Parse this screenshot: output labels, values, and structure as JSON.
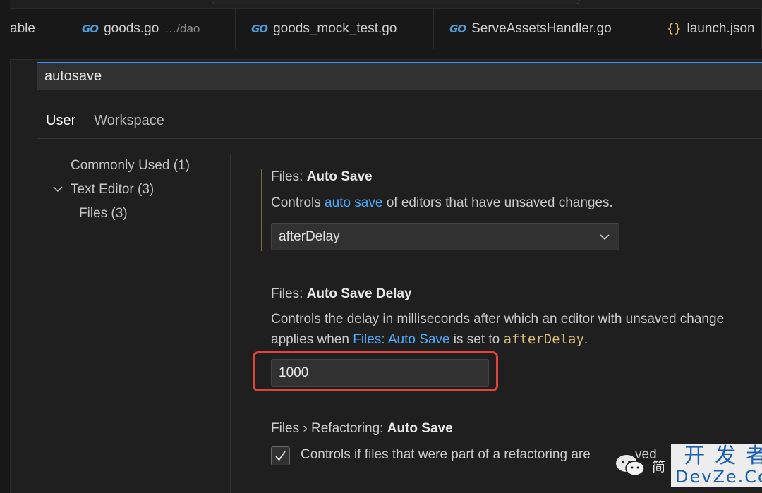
{
  "tabs": [
    {
      "label": "able",
      "icon": ""
    },
    {
      "label": "goods.go",
      "icon": "go-icon",
      "badge": "GO",
      "hint": "…/dao"
    },
    {
      "label": "goods_mock_test.go",
      "icon": "go-icon",
      "badge": "GO",
      "hint": ""
    },
    {
      "label": "ServeAssetsHandler.go",
      "icon": "go-icon",
      "badge": "GO",
      "hint": ""
    },
    {
      "label": "launch.json",
      "icon": "json-icon",
      "badge": "{}",
      "hint": ""
    }
  ],
  "search": {
    "value": "autosave"
  },
  "scopes": [
    {
      "label": "User",
      "active": true
    },
    {
      "label": "Workspace",
      "active": false
    }
  ],
  "toc": {
    "commonly_used": "Commonly Used (1)",
    "text_editor": "Text Editor (3)",
    "files": "Files (3)"
  },
  "settings": {
    "auto_save": {
      "category": "Files: ",
      "name": "Auto Save",
      "desc_before": "Controls ",
      "desc_link": "auto save",
      "desc_after": " of editors that have unsaved changes.",
      "value": "afterDelay"
    },
    "auto_save_delay": {
      "category": "Files: ",
      "name": "Auto Save Delay",
      "desc_line1": "Controls the delay in milliseconds after which an editor with unsaved change",
      "desc_line2_before": "applies when ",
      "desc_line2_link": "Files: Auto Save",
      "desc_line2_mid": " is set to ",
      "desc_line2_code": "afterDelay",
      "desc_line2_after": ".",
      "value": "1000"
    },
    "refactoring_auto_save": {
      "category": "Files › Refactoring: ",
      "name": "Auto Save",
      "desc": "Controls if files that were part of a refactoring are",
      "desc_tail": "ved",
      "checked": true
    }
  },
  "watermark": {
    "cn": "开发者",
    "en": "DevZe.CoM",
    "glyph": "简"
  },
  "colors": {
    "accent": "#3794ff",
    "link": "#4daafc",
    "highlight_box": "#e0443a",
    "code": "#d7ba7d"
  }
}
